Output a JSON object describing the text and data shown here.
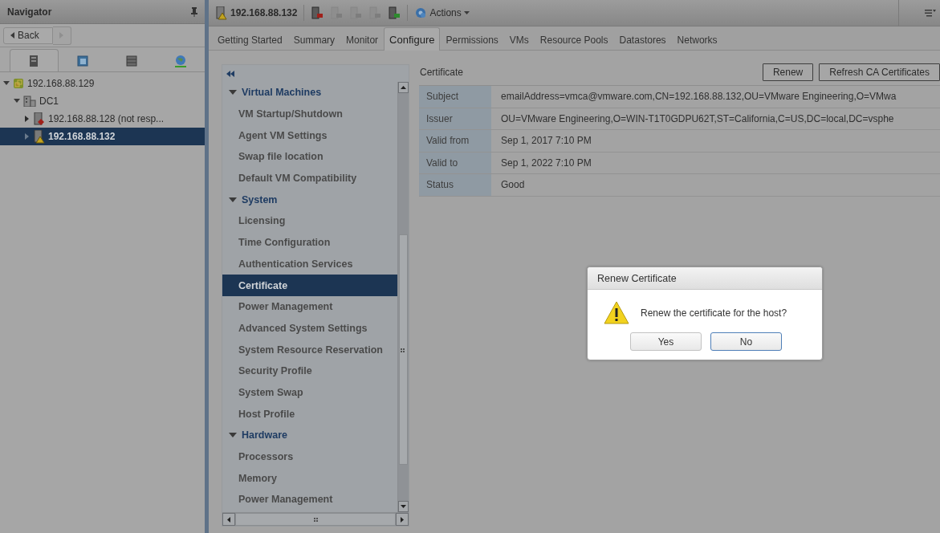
{
  "navigator": {
    "title": "Navigator",
    "back_button": "Back",
    "tabs": [
      {
        "kind": "hosts",
        "selected": true
      },
      {
        "kind": "vms",
        "selected": false
      },
      {
        "kind": "storage",
        "selected": false
      },
      {
        "kind": "network",
        "selected": false
      }
    ],
    "tree": [
      {
        "label": "192.168.88.129",
        "kind": "vcenter",
        "expanded": true,
        "selected": false,
        "children": [
          {
            "label": "DC1",
            "kind": "datacenter",
            "expanded": true,
            "selected": false,
            "children": [
              {
                "label": "192.168.88.128 (not resp...",
                "kind": "host-error",
                "expanded": false,
                "selected": false
              },
              {
                "label": "192.168.88.132",
                "kind": "host-warning",
                "expanded": false,
                "selected": true
              }
            ]
          }
        ]
      }
    ]
  },
  "header": {
    "object": "192.168.88.132",
    "actions": "Actions"
  },
  "tabs": [
    {
      "label": "Getting Started",
      "selected": false
    },
    {
      "label": "Summary",
      "selected": false
    },
    {
      "label": "Monitor",
      "selected": false
    },
    {
      "label": "Configure",
      "selected": true
    },
    {
      "label": "Permissions",
      "selected": false
    },
    {
      "label": "VMs",
      "selected": false
    },
    {
      "label": "Resource Pools",
      "selected": false
    },
    {
      "label": "Datastores",
      "selected": false
    },
    {
      "label": "Networks",
      "selected": false
    }
  ],
  "config_nav": {
    "sections": [
      {
        "label": "Virtual Machines",
        "expanded": true,
        "items": [
          {
            "label": "VM Startup/Shutdown",
            "selected": false
          },
          {
            "label": "Agent VM Settings",
            "selected": false
          },
          {
            "label": "Swap file location",
            "selected": false
          },
          {
            "label": "Default VM Compatibility",
            "selected": false
          }
        ]
      },
      {
        "label": "System",
        "expanded": true,
        "items": [
          {
            "label": "Licensing",
            "selected": false
          },
          {
            "label": "Time Configuration",
            "selected": false
          },
          {
            "label": "Authentication Services",
            "selected": false
          },
          {
            "label": "Certificate",
            "selected": true
          },
          {
            "label": "Power Management",
            "selected": false
          },
          {
            "label": "Advanced System Settings",
            "selected": false
          },
          {
            "label": "System Resource Reservation",
            "selected": false
          },
          {
            "label": "Security Profile",
            "selected": false
          },
          {
            "label": "System Swap",
            "selected": false
          },
          {
            "label": "Host Profile",
            "selected": false
          }
        ]
      },
      {
        "label": "Hardware",
        "expanded": true,
        "items": [
          {
            "label": "Processors",
            "selected": false
          },
          {
            "label": "Memory",
            "selected": false
          },
          {
            "label": "Power Management",
            "selected": false
          }
        ]
      }
    ]
  },
  "detail": {
    "title": "Certificate",
    "buttons": [
      "Renew",
      "Refresh CA Certificates"
    ],
    "rows": [
      {
        "label": "Subject",
        "value": "emailAddress=vmca@vmware.com,CN=192.168.88.132,OU=VMware Engineering,O=VMwa"
      },
      {
        "label": "Issuer",
        "value": "OU=VMware Engineering,O=WIN-T1T0GDPU62T,ST=California,C=US,DC=local,DC=vsphe"
      },
      {
        "label": "Valid from",
        "value": "Sep 1, 2017 7:10 PM"
      },
      {
        "label": "Valid to",
        "value": "Sep 1, 2022 7:10 PM"
      },
      {
        "label": "Status",
        "value": "Good"
      }
    ]
  },
  "dialog": {
    "title": "Renew Certificate",
    "message": "Renew the certificate for the host?",
    "buttons": [
      {
        "label": "Yes",
        "default": false
      },
      {
        "label": "No",
        "default": true
      }
    ]
  }
}
